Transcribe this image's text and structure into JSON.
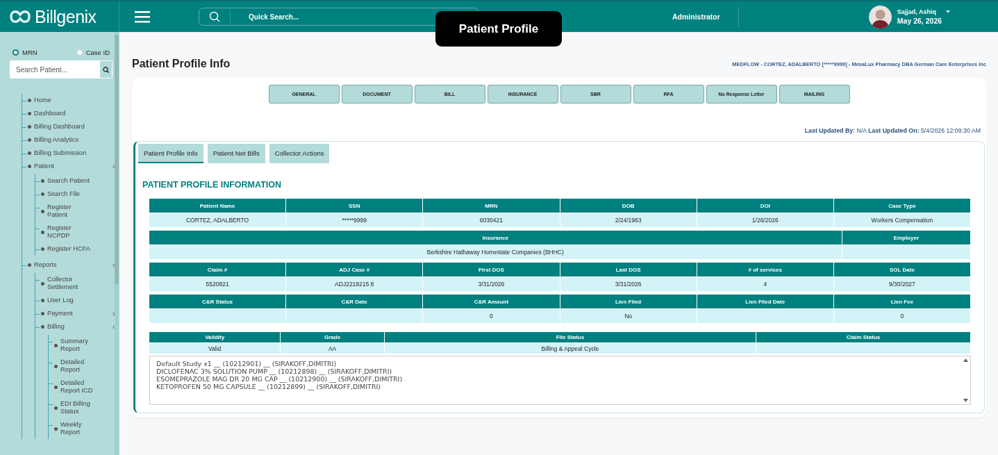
{
  "header": {
    "logo": "Billgenix",
    "search": {
      "placeholder": "Quick Search..."
    },
    "role": "Administrator",
    "user": {
      "name": "Sajjad, Ashiq",
      "date": "May 26, 2026"
    }
  },
  "tooltip": "Patient Profile",
  "sidebar": {
    "search_by": [
      {
        "label": "MRN",
        "selected": true
      },
      {
        "label": "Case ID",
        "selected": false
      }
    ],
    "search": {
      "placeholder": "Search Patient..."
    },
    "items": [
      {
        "label": "Home"
      },
      {
        "label": "Dashboard"
      },
      {
        "label": "Billing Dashboard"
      },
      {
        "label": "Billing Analytics"
      },
      {
        "label": "Billing Submission"
      },
      {
        "label": "Patient",
        "expanded": true,
        "children": [
          {
            "label": "Search Patient"
          },
          {
            "label": "Search File"
          },
          {
            "label": "Register Patient"
          },
          {
            "label": "Register NCPDP"
          },
          {
            "label": "Register HCFA"
          }
        ]
      },
      {
        "label": "Reports",
        "expanded": true,
        "children": [
          {
            "label": "Collector Settlement"
          },
          {
            "label": "User Log"
          },
          {
            "label": "Payment",
            "expanded": false
          },
          {
            "label": "Billing",
            "expanded": true,
            "children": [
              {
                "label": "Summary Report"
              },
              {
                "label": "Detailed Report"
              },
              {
                "label": "Detailed Report ICD"
              },
              {
                "label": "EDI Billing Status"
              },
              {
                "label": "Weekly Report"
              }
            ]
          }
        ]
      }
    ]
  },
  "page": {
    "title": "Patient Profile Info",
    "context": "MEDFLOW - CORTEZ, ADALBERTO [*****9999] - MesaLux Pharmacy DBA German Care Enterprises Inc"
  },
  "nav_buttons": [
    "GENERAL",
    "DOCUMENT",
    "BILL",
    "INSURANCE",
    "SBR",
    "RFA",
    "No Response Letter",
    "MAILING"
  ],
  "last_updated": "**Last Updated By:** N/A **Last Updated On:** 5/4/2026 12:09:30 AM",
  "tabs": [
    {
      "label": "Patient Profile Info",
      "selected": true
    },
    {
      "label": "Patient Net Bills",
      "selected": false
    },
    {
      "label": "Collector Actions",
      "selected": false
    }
  ],
  "section_title": "PATIENT PROFILE INFORMATION",
  "tables": [
    {
      "columns": [
        "Patient Name",
        "SSN",
        "MRN",
        "DOB",
        "DOI",
        "Case Type"
      ],
      "cells": [
        "CORTEZ, ADALBERTO",
        "*****9999",
        "6030421",
        "2/24/1963",
        "1/26/2026",
        "Workers Compensation"
      ]
    },
    {
      "columns": [
        "Insurance",
        "Employer"
      ],
      "cells": [
        "Berkshire Hathaway Homestate Companies (BHHC)",
        ""
      ]
    },
    {
      "columns": [
        "Claim #",
        "ADJ Case #",
        "First DOS",
        "Last DOS",
        "# of services",
        "SOL Date"
      ],
      "cells": [
        "5520821",
        "ADJ2219215 8",
        "3/31/2026",
        "3/31/2026",
        "4",
        "9/30/2027"
      ]
    },
    {
      "columns": [
        "C&R Status",
        "C&R Date",
        "C&R Amount",
        "Lien Filed",
        "Lien Filed Date",
        "Lien Fee"
      ],
      "cells": [
        "",
        "",
        "0",
        "No",
        "",
        "0"
      ]
    },
    {
      "columns": [
        "Validity",
        "Grade",
        "File Status",
        "Claim Status"
      ],
      "cells": [
        "Valid",
        "AA",
        "Billing & Appeal Cycle",
        ""
      ]
    }
  ],
  "studies": [
    "Default Study x1 __ (10212901) __ (SIRAKOFF,DIMITRI)",
    "DICLOFENAC 3% SOLUTION PUMP __ (10212898) __ (SIRAKOFF,DIMITRI)",
    "ESOMEPRAZOLE MAG DR 20 MG CAP __ (10212900) __ (SIRAKOFF,DIMITRI)",
    "KETOPROFEN 50 MG CAPSULE __ (10212899) __ (SIRAKOFF,DIMITRI)"
  ]
}
